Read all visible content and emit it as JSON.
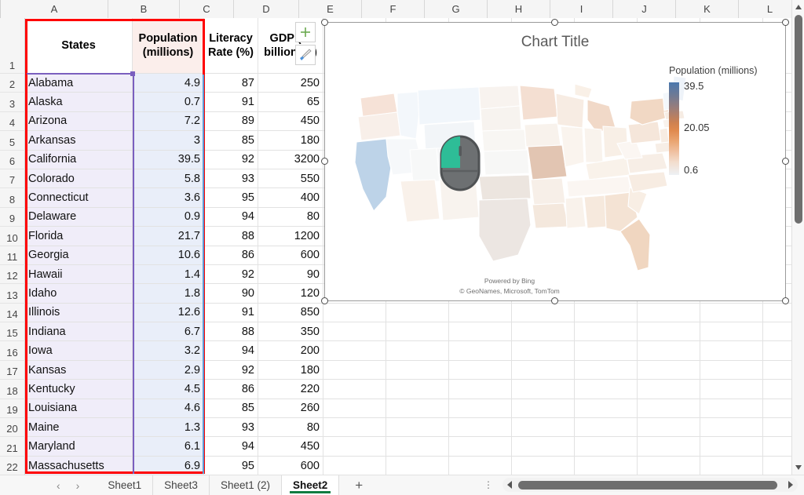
{
  "grid": {
    "columns": [
      "A",
      "B",
      "C",
      "D",
      "E",
      "F",
      "G",
      "H",
      "I",
      "J",
      "K",
      "L"
    ],
    "headers": {
      "a": "States",
      "b": "Population (millions)",
      "c": "Literacy Rate (%)",
      "d": "GDP (in billions $)"
    },
    "row_numbers": [
      "1",
      "2",
      "3",
      "4",
      "5",
      "6",
      "7",
      "8",
      "9",
      "10",
      "11",
      "12",
      "13",
      "14",
      "15",
      "16",
      "17",
      "18",
      "19",
      "20",
      "21",
      "22"
    ],
    "rows": [
      {
        "n": "2",
        "state": "Alabama",
        "population": "4.9",
        "literacy": "87",
        "gdp": "250"
      },
      {
        "n": "3",
        "state": "Alaska",
        "population": "0.7",
        "literacy": "91",
        "gdp": "65"
      },
      {
        "n": "4",
        "state": "Arizona",
        "population": "7.2",
        "literacy": "89",
        "gdp": "450"
      },
      {
        "n": "5",
        "state": "Arkansas",
        "population": "3",
        "literacy": "85",
        "gdp": "180"
      },
      {
        "n": "6",
        "state": "California",
        "population": "39.5",
        "literacy": "92",
        "gdp": "3200"
      },
      {
        "n": "7",
        "state": "Colorado",
        "population": "5.8",
        "literacy": "93",
        "gdp": "550"
      },
      {
        "n": "8",
        "state": "Connecticut",
        "population": "3.6",
        "literacy": "95",
        "gdp": "400"
      },
      {
        "n": "9",
        "state": "Delaware",
        "population": "0.9",
        "literacy": "94",
        "gdp": "80"
      },
      {
        "n": "10",
        "state": "Florida",
        "population": "21.7",
        "literacy": "88",
        "gdp": "1200"
      },
      {
        "n": "11",
        "state": "Georgia",
        "population": "10.6",
        "literacy": "86",
        "gdp": "600"
      },
      {
        "n": "12",
        "state": "Hawaii",
        "population": "1.4",
        "literacy": "92",
        "gdp": "90"
      },
      {
        "n": "13",
        "state": "Idaho",
        "population": "1.8",
        "literacy": "90",
        "gdp": "120"
      },
      {
        "n": "14",
        "state": "Illinois",
        "population": "12.6",
        "literacy": "91",
        "gdp": "850"
      },
      {
        "n": "15",
        "state": "Indiana",
        "population": "6.7",
        "literacy": "88",
        "gdp": "350"
      },
      {
        "n": "16",
        "state": "Iowa",
        "population": "3.2",
        "literacy": "94",
        "gdp": "200"
      },
      {
        "n": "17",
        "state": "Kansas",
        "population": "2.9",
        "literacy": "92",
        "gdp": "180"
      },
      {
        "n": "18",
        "state": "Kentucky",
        "population": "4.5",
        "literacy": "86",
        "gdp": "220"
      },
      {
        "n": "19",
        "state": "Louisiana",
        "population": "4.6",
        "literacy": "85",
        "gdp": "260"
      },
      {
        "n": "20",
        "state": "Maine",
        "population": "1.3",
        "literacy": "93",
        "gdp": "80"
      },
      {
        "n": "21",
        "state": "Maryland",
        "population": "6.1",
        "literacy": "94",
        "gdp": "450"
      },
      {
        "n": "22",
        "state": "Massachusetts",
        "population": "6.9",
        "literacy": "95",
        "gdp": "600"
      }
    ],
    "selection_highlight_color": "#ff0000"
  },
  "chart": {
    "title": "Chart Title",
    "legend_title": "Population (millions)",
    "legend_max": "39.5",
    "legend_mid": "20.05",
    "legend_min": "0.6",
    "attribution_line1": "Powered by Bing",
    "attribution_line2": "© GeoNames, Microsoft, TomTom",
    "buttons": {
      "chart_elements": "chart-elements-plus-icon",
      "chart_styles": "chart-styles-brush-icon"
    }
  },
  "chart_data": {
    "type": "heatmap",
    "title": "Chart Title",
    "subtitle": "",
    "xlabel": "",
    "ylabel": "",
    "legend_position": "right",
    "legend_title": "Population (millions)",
    "colorbar_ticks": [
      "39.5",
      "20.05",
      "0.6"
    ],
    "colorbar_range": [
      0.6,
      39.5
    ],
    "colorscale": [
      "#eef1f5",
      "#e08a4e",
      "#4a77ad"
    ],
    "grid": false,
    "categories": [
      "Alabama",
      "Alaska",
      "Arizona",
      "Arkansas",
      "California",
      "Colorado",
      "Connecticut",
      "Delaware",
      "Florida",
      "Georgia",
      "Hawaii",
      "Idaho",
      "Illinois",
      "Indiana",
      "Iowa",
      "Kansas",
      "Kentucky",
      "Louisiana",
      "Maine",
      "Maryland",
      "Massachusetts"
    ],
    "values": [
      4.9,
      0.7,
      7.2,
      3,
      39.5,
      5.8,
      3.6,
      0.9,
      21.7,
      10.6,
      1.4,
      1.8,
      12.6,
      6.7,
      3.2,
      2.9,
      4.5,
      4.6,
      1.3,
      6.1,
      6.9
    ],
    "series": [
      {
        "name": "Population (millions)",
        "values": [
          4.9,
          0.7,
          7.2,
          3,
          39.5,
          5.8,
          3.6,
          0.9,
          21.7,
          10.6,
          1.4,
          1.8,
          12.6,
          6.7,
          3.2,
          2.9,
          4.5,
          4.6,
          1.3,
          6.1,
          6.9
        ]
      },
      {
        "name": "Literacy Rate (%)",
        "values": [
          87,
          91,
          89,
          85,
          92,
          93,
          95,
          94,
          88,
          86,
          92,
          90,
          91,
          88,
          94,
          92,
          86,
          85,
          93,
          94,
          95
        ]
      },
      {
        "name": "GDP (in billions $)",
        "values": [
          250,
          65,
          450,
          180,
          3200,
          550,
          400,
          80,
          1200,
          600,
          90,
          120,
          850,
          350,
          200,
          180,
          220,
          260,
          80,
          450,
          600
        ]
      }
    ]
  },
  "cursor": {
    "type": "mouse-pointer-graphic",
    "highlight_color": "#2ebd97",
    "body_color": "#6d7072"
  },
  "sheetbar": {
    "prev_label": "‹",
    "next_label": "›",
    "tabs": [
      {
        "label": "Sheet1",
        "active": false
      },
      {
        "label": "Sheet3",
        "active": false
      },
      {
        "label": "Sheet1 (2)",
        "active": false
      },
      {
        "label": "Sheet2",
        "active": true
      }
    ],
    "add_label": "+",
    "active_accent": "#107c41"
  }
}
